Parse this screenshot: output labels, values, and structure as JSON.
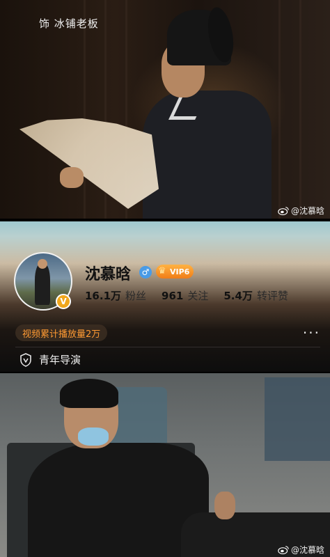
{
  "top_photo": {
    "caption": "饰 冰铺老板",
    "watermark": "@沈慕晗",
    "watermark_icon": "weibo-icon"
  },
  "profile": {
    "name": "沈慕晗",
    "gender_icon": "male-icon",
    "gender_symbol": "♂",
    "vip_label": "VIP6",
    "vip_icon": "crown-icon",
    "verified_icon": "verified-v-icon",
    "verified_symbol": "V",
    "stats": [
      {
        "value": "16.1万",
        "label": "粉丝"
      },
      {
        "value": "961",
        "label": "关注"
      },
      {
        "value": "5.4万",
        "label": "转评赞"
      }
    ],
    "play_badge": "视频累计播放量2万",
    "more_symbol": "···",
    "title_icon": "shield-v-icon",
    "title": "青年导演",
    "colors": {
      "vip_orange": "#f07d16",
      "badge_text": "#ff9a33",
      "verified_gold": "#f0a71c",
      "gender_blue": "#4a9be6"
    }
  },
  "bottom_photo": {
    "watermark": "@沈慕晗",
    "watermark_icon": "weibo-icon"
  }
}
